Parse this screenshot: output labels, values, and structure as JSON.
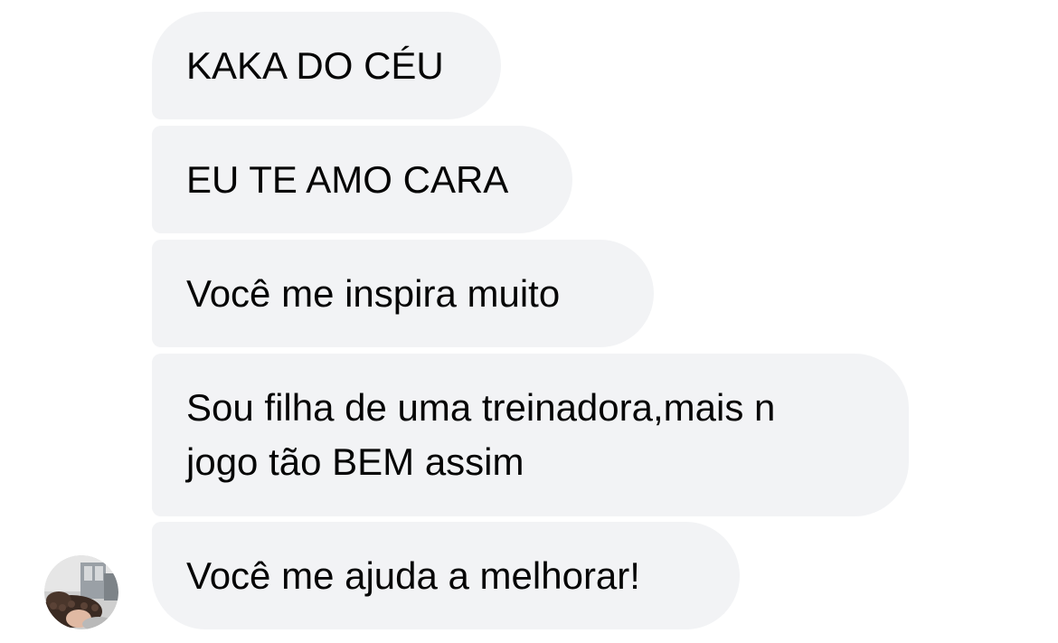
{
  "messages": [
    {
      "text": "KAKA DO CÉU"
    },
    {
      "text": "EU TE AMO CARA"
    },
    {
      "text": "Você me inspira muito"
    },
    {
      "text": "Sou filha de uma treinadora,mais n\njogo tão BEM assim"
    },
    {
      "text": "Você me ajuda a melhorar!"
    }
  ],
  "colors": {
    "bubble_bg": "#f2f3f5",
    "text": "#050505",
    "background": "#ffffff"
  }
}
